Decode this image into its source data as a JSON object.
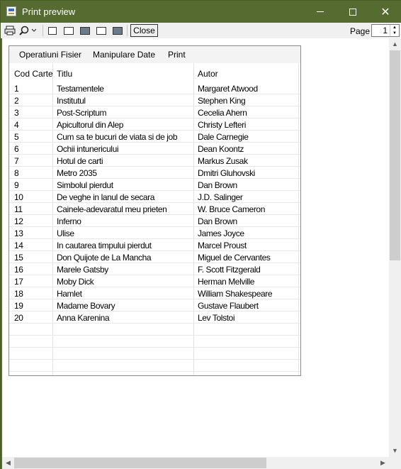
{
  "window": {
    "title": "Print preview"
  },
  "toolbar": {
    "close_label": "Close",
    "page_label": "Page",
    "page_value": "1",
    "icons": [
      "print-icon",
      "zoom-icon",
      "one-page-icon",
      "two-pages-icon",
      "three-pages-icon",
      "four-pages-icon",
      "six-pages-icon"
    ]
  },
  "document": {
    "menu": [
      "Operatiuni Fisier",
      "Manipulare Date",
      "Print"
    ],
    "columns": [
      "Cod Carte",
      "Titlu",
      "Autor"
    ],
    "rows": [
      [
        "1",
        "Testamentele",
        "Margaret Atwood"
      ],
      [
        "2",
        "Institutul",
        "Stephen King"
      ],
      [
        "3",
        "Post-Scriptum",
        "Cecelia Ahern"
      ],
      [
        "4",
        "Apicultorul din Alep",
        "Christy Lefteri"
      ],
      [
        "5",
        "Cum sa te bucuri de viata si de job",
        "Dale Carnegie"
      ],
      [
        "6",
        "Ochii intunericului",
        "Dean Koontz"
      ],
      [
        "7",
        "Hotul de carti",
        "Markus Zusak"
      ],
      [
        "8",
        "Metro 2035",
        "Dmitri Gluhovski"
      ],
      [
        "9",
        "Simbolul pierdut",
        "Dan Brown"
      ],
      [
        "10",
        "De veghe in lanul de secara",
        "J.D. Salinger"
      ],
      [
        "11",
        "Cainele-adevaratul meu prieten",
        "W. Bruce Cameron"
      ],
      [
        "12",
        "Inferno",
        "Dan Brown"
      ],
      [
        "13",
        "Ulise",
        "James Joyce"
      ],
      [
        "14",
        "In cautarea timpului pierdut",
        "Marcel Proust"
      ],
      [
        "15",
        "Don Quijote de La Mancha",
        "Miguel de Cervantes"
      ],
      [
        "16",
        "Marele Gatsby",
        "F. Scott Fitzgerald"
      ],
      [
        "17",
        "Moby Dick",
        "Herman Melville"
      ],
      [
        "18",
        "Hamlet",
        "William Shakespeare"
      ],
      [
        "19",
        "Madame Bovary",
        "Gustave Flaubert"
      ],
      [
        "20",
        "Anna Karenina",
        "Lev Tolstoi"
      ]
    ]
  },
  "colors": {
    "titlebar": "#556b2f",
    "toolbar": "#f0f0f0",
    "page": "#ffffff"
  }
}
